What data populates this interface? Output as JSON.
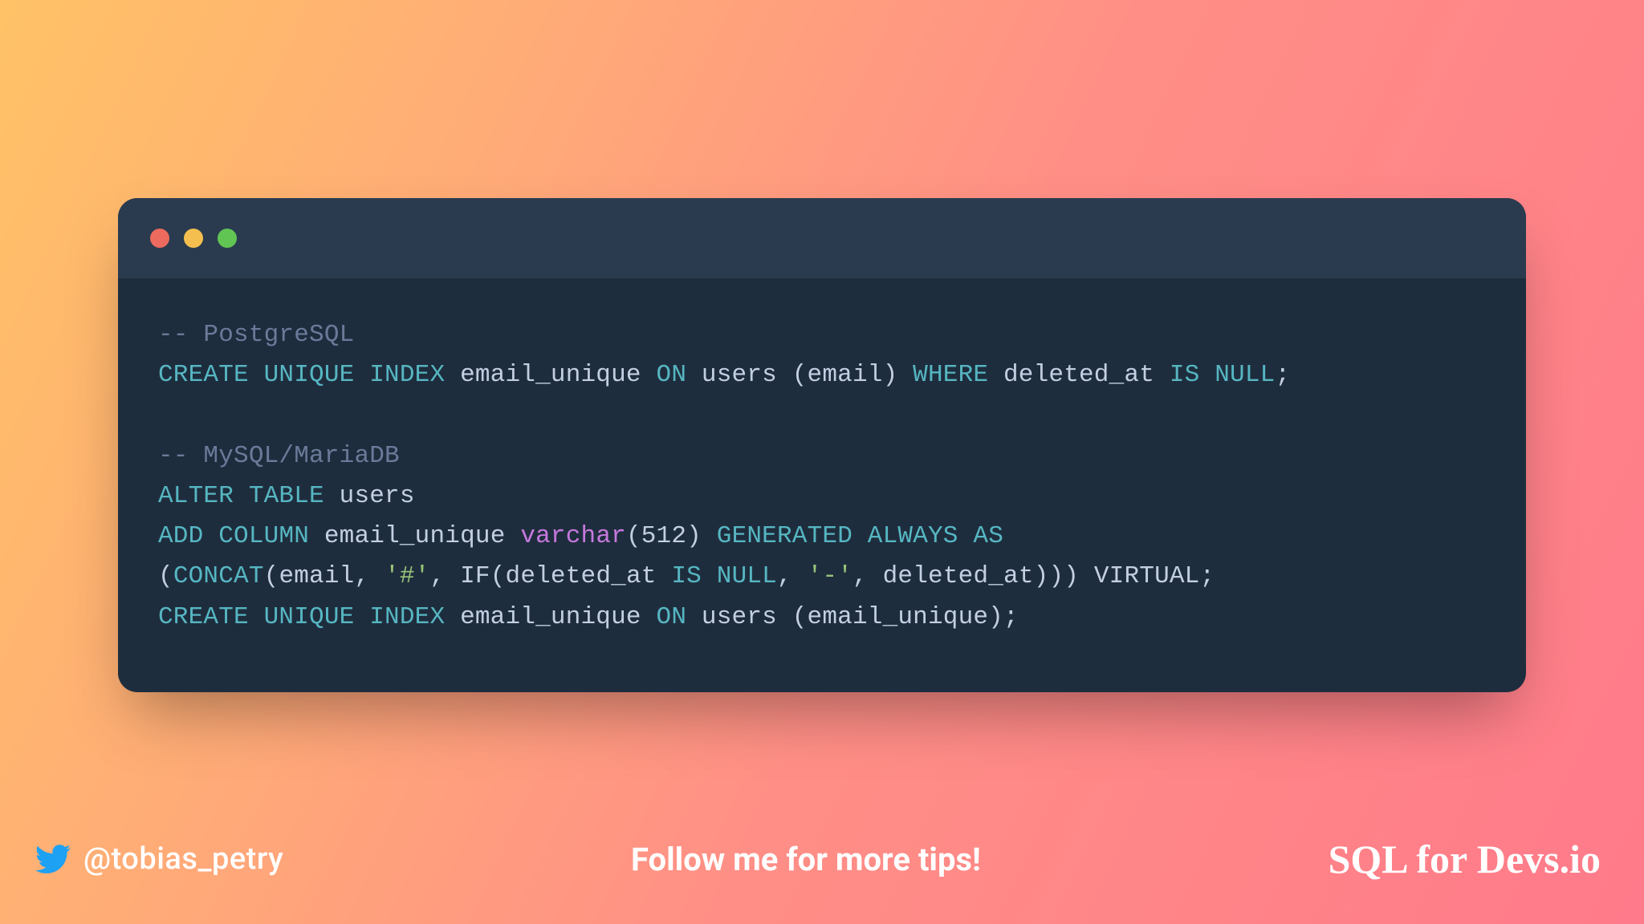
{
  "code": {
    "tokens": [
      {
        "t": "-- PostgreSQL",
        "c": "tok-comment"
      },
      {
        "t": "\n"
      },
      {
        "t": "CREATE UNIQUE INDEX",
        "c": "tok-keyword"
      },
      {
        "t": " email_unique "
      },
      {
        "t": "ON",
        "c": "tok-keyword"
      },
      {
        "t": " users (email) "
      },
      {
        "t": "WHERE",
        "c": "tok-keyword"
      },
      {
        "t": " deleted_at "
      },
      {
        "t": "IS NULL",
        "c": "tok-keyword"
      },
      {
        "t": ";"
      },
      {
        "t": "\n"
      },
      {
        "t": "\n"
      },
      {
        "t": "-- MySQL/MariaDB",
        "c": "tok-comment"
      },
      {
        "t": "\n"
      },
      {
        "t": "ALTER TABLE",
        "c": "tok-keyword"
      },
      {
        "t": " users"
      },
      {
        "t": "\n"
      },
      {
        "t": "ADD",
        "c": "tok-keyword"
      },
      {
        "t": " "
      },
      {
        "t": "COLUMN",
        "c": "tok-keyword"
      },
      {
        "t": " email_unique "
      },
      {
        "t": "varchar",
        "c": "tok-type"
      },
      {
        "t": "(512) "
      },
      {
        "t": "GENERATED ALWAYS AS",
        "c": "tok-keyword"
      },
      {
        "t": "\n"
      },
      {
        "t": "("
      },
      {
        "t": "CONCAT",
        "c": "tok-keyword"
      },
      {
        "t": "(email, "
      },
      {
        "t": "'#'",
        "c": "tok-string"
      },
      {
        "t": ", IF(deleted_at "
      },
      {
        "t": "IS NULL",
        "c": "tok-keyword"
      },
      {
        "t": ", "
      },
      {
        "t": "'-'",
        "c": "tok-string"
      },
      {
        "t": ", deleted_at))) VIRTUAL;"
      },
      {
        "t": "\n"
      },
      {
        "t": "CREATE UNIQUE INDEX",
        "c": "tok-keyword"
      },
      {
        "t": " email_unique "
      },
      {
        "t": "ON",
        "c": "tok-keyword"
      },
      {
        "t": " users (email_unique);"
      }
    ]
  },
  "footer": {
    "handle": "@tobias_petry",
    "cta": "Follow me for more tips!",
    "brand": "SQL for Devs.io"
  }
}
